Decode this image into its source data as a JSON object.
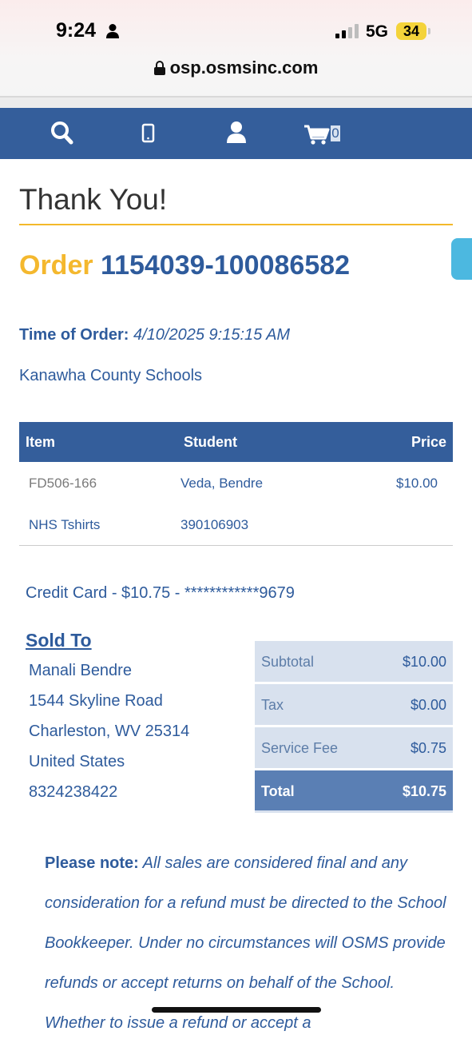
{
  "status_bar": {
    "time": "9:24",
    "network": "5G",
    "battery": "34",
    "url": "osp.osmsinc.com"
  },
  "nav": {
    "cart_count": "0",
    "icons": [
      "search-icon",
      "mobile-phone-icon",
      "user-icon",
      "shopping-cart-icon"
    ]
  },
  "page": {
    "title": "Thank You!",
    "order_word": "Order",
    "order_number": "1154039-100086582",
    "time_label": "Time of Order:",
    "time_value": "4/10/2025 9:15:15 AM",
    "organization": "Kanawha County Schools"
  },
  "items_table": {
    "headers": [
      "Item",
      "Student",
      "Price"
    ],
    "rows": [
      {
        "item": "FD506-166",
        "student": "Veda, Bendre",
        "price": "$10.00"
      },
      {
        "item": "NHS Tshirts",
        "student": "390106903",
        "price": ""
      }
    ]
  },
  "payment": {
    "line": "Credit Card - $10.75 - ************9679"
  },
  "sold_to": {
    "title": "Sold To",
    "name": "Manali Bendre",
    "street": "1544 Skyline Road",
    "city": "Charleston, WV 25314",
    "country": "United States",
    "phone": "8324238422"
  },
  "totals": [
    {
      "label": "Subtotal",
      "value": "$10.00"
    },
    {
      "label": "Tax",
      "value": "$0.00"
    },
    {
      "label": "Service Fee",
      "value": "$0.75"
    },
    {
      "label": "Total",
      "value": "$10.75"
    }
  ],
  "note": {
    "label": "Please note:",
    "text": "All sales are considered final and any consideration for a refund must be directed to the School Bookkeeper. Under no circumstances will OSMS provide refunds or accept returns on behalf of the School. Whether to issue a refund or accept a"
  },
  "colors": {
    "brand_blue": "#345e9b",
    "text_blue": "#2e5b9c",
    "accent_gold": "#f4b82e",
    "totals_bg": "#d8e1ee",
    "total_row_bg": "#5a7fb4"
  }
}
